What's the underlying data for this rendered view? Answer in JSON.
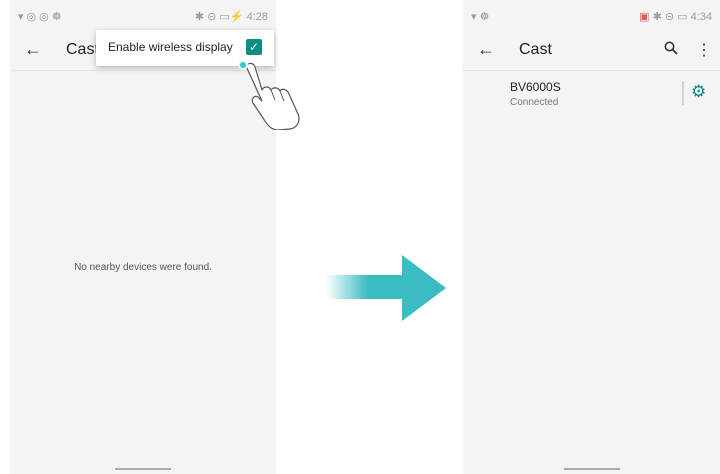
{
  "left_screen": {
    "status_left": "▾◎◎☸",
    "status_right": "✱ ⊝ ▭⚡ 4:28",
    "title": "Cast",
    "back_icon": "←",
    "menu_option": "Enable wireless display",
    "checkbox_mark": "✓",
    "empty_message": "No nearby devices were found."
  },
  "right_screen": {
    "status_left": "▾☸",
    "status_warn": "▣",
    "status_right": " ✱ ⊝ ▭ 4:34",
    "title": "Cast",
    "back_icon": "←",
    "search_icon": "🔍",
    "more_icon": "⋮",
    "device": {
      "name": "BV6000S",
      "status": "Connected"
    },
    "gear_icon": "⚙"
  },
  "colors": {
    "accent": "#0f8c84",
    "arrow": "#3bbcc2",
    "background": "#f4f4f4"
  }
}
